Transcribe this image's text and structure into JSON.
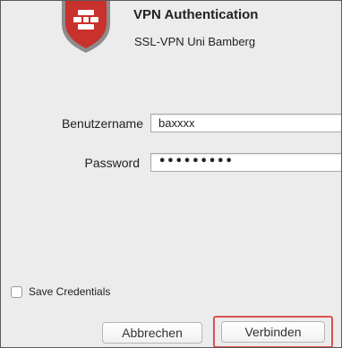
{
  "dialog": {
    "title": "VPN Authentication",
    "subtitle": "SSL-VPN Uni Bamberg"
  },
  "form": {
    "username_label": "Benutzername",
    "username_value": "baxxxx",
    "password_label": "Password",
    "password_value": "•••••••••"
  },
  "options": {
    "save_credentials_label": "Save Credentials",
    "save_credentials_checked": false
  },
  "buttons": {
    "cancel_label": "Abbrechen",
    "connect_label": "Verbinden"
  },
  "colors": {
    "logo_red": "#c8312c",
    "highlight_border": "#d9534f"
  },
  "icons": {
    "logo": "forticlient-shield-icon"
  }
}
